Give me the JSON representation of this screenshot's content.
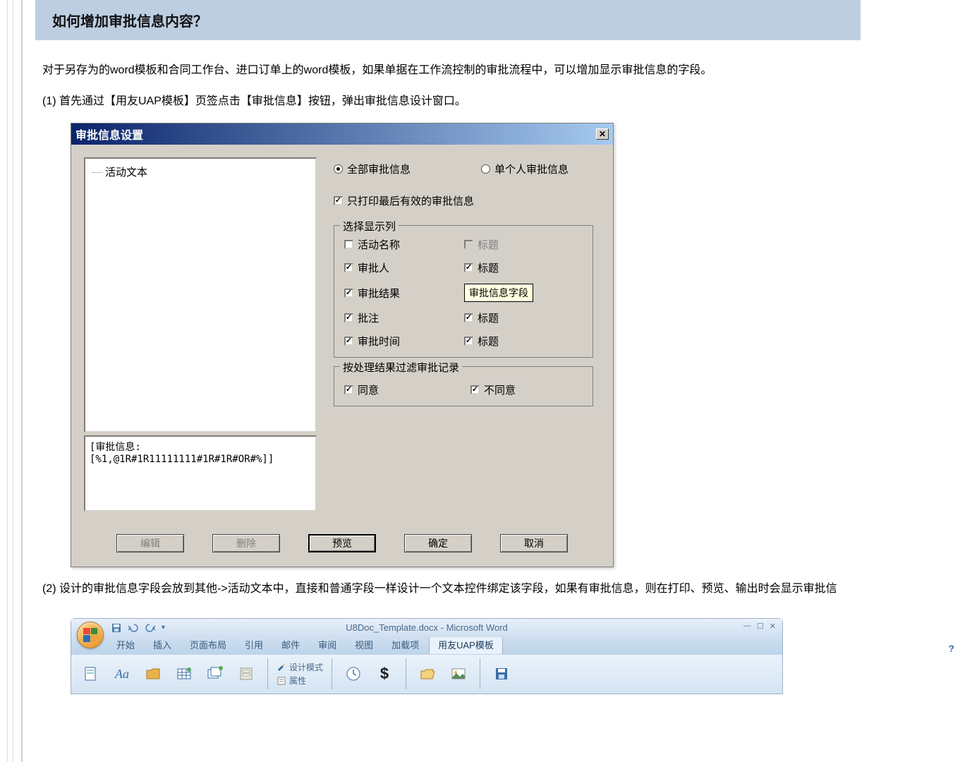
{
  "section_title": "如何增加审批信息内容？",
  "para1": "对于另存为的word模板和合同工作台、进口订单上的word模板，如果单据在工作流控制的审批流程中，可以增加显示审批信息的字段。",
  "para2": "(1) 首先通过【用友UAP模板】页签点击【审批信息】按钮，弹出审批信息设计窗口。",
  "para3": "(2) 设计的审批信息字段会放到其他->活动文本中，直接和普通字段一样设计一个文本控件绑定该字段，如果有审批信息，则在打印、预览、输出时会显示审批信",
  "dialog": {
    "title": "审批信息设置",
    "tree_item": "活动文本",
    "code_text": "[审批信息:[%1,@1R#1R11111111#1R#1R#OR#%]]",
    "radio_all": "全部审批信息",
    "radio_single": "单个人审批信息",
    "chk_print_last": "只打印最后有效的审批信息",
    "group_columns": "选择显示列",
    "group_filter": "按处理结果过滤审批记录",
    "cols": {
      "activity_name": "活动名称",
      "approver": "审批人",
      "result": "审批结果",
      "note": "批注",
      "time": "审批时间",
      "title_disabled": "标题",
      "title2": "标题",
      "title3": "标题",
      "title4": "标题"
    },
    "tooltip": "审批信息字段",
    "filter_agree": "同意",
    "filter_disagree": "不同意",
    "buttons": {
      "edit": "编辑",
      "delete": "删除",
      "preview": "预览",
      "ok": "确定",
      "cancel": "取消"
    }
  },
  "word": {
    "title": "U8Doc_Template.docx - Microsoft Word",
    "tabs": [
      "开始",
      "插入",
      "页面布局",
      "引用",
      "邮件",
      "审阅",
      "视图",
      "加载项",
      "用友UAP模板"
    ],
    "design_mode": "设计模式",
    "properties": "属性",
    "aa_label": "Aa"
  }
}
